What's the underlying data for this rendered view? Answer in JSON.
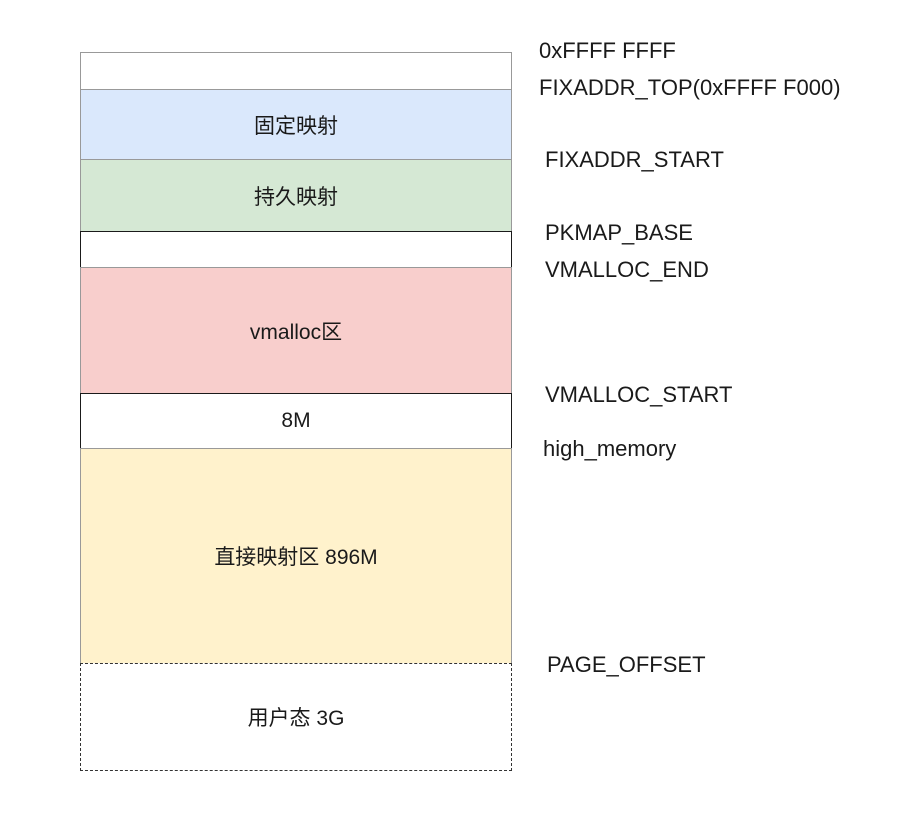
{
  "segments": {
    "top": "",
    "fixmap": "固定映射",
    "pkmap": "持久映射",
    "gap1": "",
    "vmalloc": "vmalloc区",
    "guard": "8M",
    "direct": "直接映射区 896M",
    "user": "用户态 3G"
  },
  "addresses": {
    "top_end": "0xFFFF FFFF",
    "fixaddr_top": "FIXADDR_TOP(0xFFFF F000)",
    "fixaddr_start": "FIXADDR_START",
    "pkmap_base": "PKMAP_BASE",
    "vmalloc_end": "VMALLOC_END",
    "vmalloc_start": "VMALLOC_START",
    "high_memory": "high_memory",
    "page_offset": "PAGE_OFFSET"
  },
  "colors": {
    "fixmap": "#dae8fc",
    "pkmap": "#d5e8d4",
    "vmalloc": "#f8cecc",
    "direct": "#fff2cc"
  }
}
